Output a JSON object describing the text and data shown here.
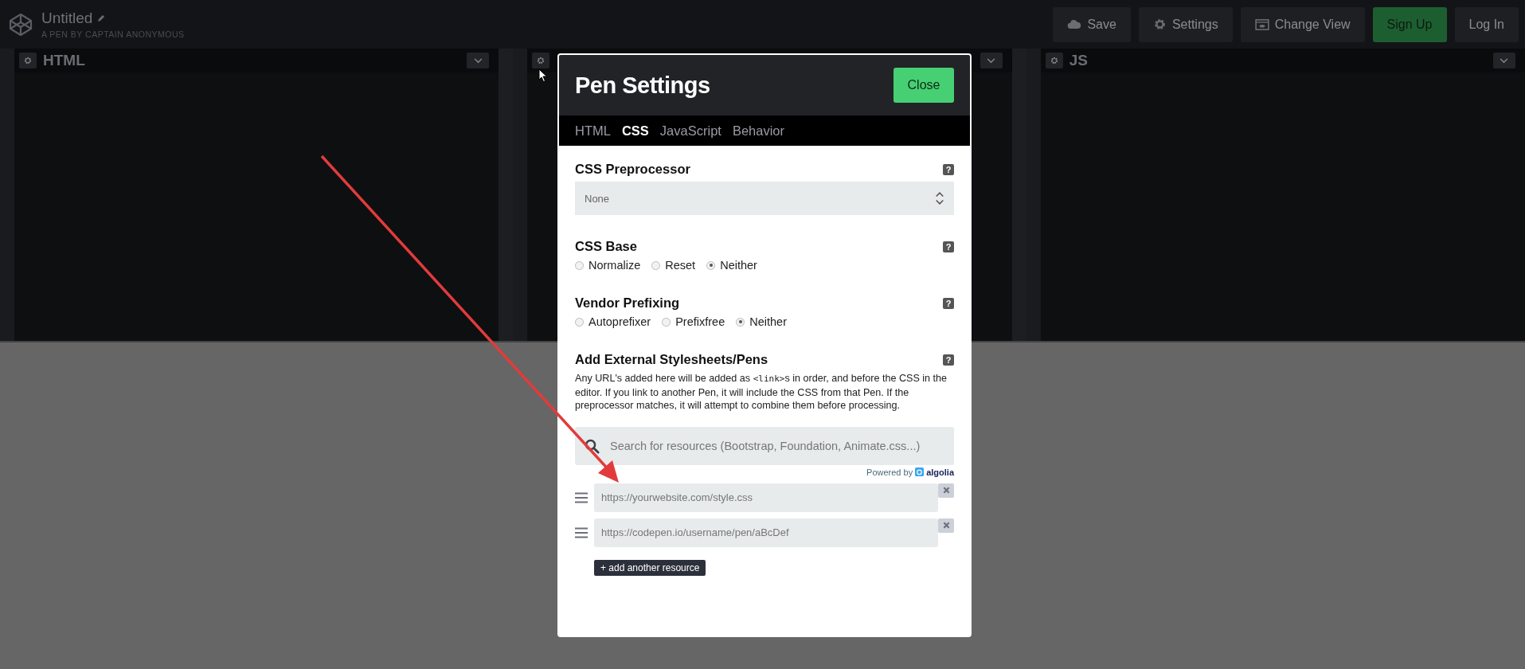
{
  "header": {
    "title": "Untitled",
    "subtitle": "A PEN BY CAPTAIN ANONYMOUS",
    "buttons": [
      {
        "label": "Save",
        "kind": "save"
      },
      {
        "label": "Settings",
        "kind": "settings"
      },
      {
        "label": "Change View",
        "kind": "view"
      },
      {
        "label": "Sign Up",
        "kind": "signup"
      },
      {
        "label": "Log In",
        "kind": "login"
      }
    ]
  },
  "editors": [
    {
      "kind": "labeled",
      "label": "HTML"
    },
    {
      "kind": "unlabeled"
    },
    {
      "kind": "labeled",
      "label": "JS"
    }
  ],
  "modal": {
    "title": "Pen Settings",
    "close": "Close",
    "tabs": [
      {
        "label": "HTML",
        "selected": false
      },
      {
        "label": "CSS",
        "selected": true
      },
      {
        "label": "JavaScript",
        "selected": false
      },
      {
        "label": "Behavior",
        "selected": false
      }
    ],
    "sections": [
      {
        "kind": "select",
        "heading": "CSS Preprocessor",
        "help": "?",
        "value": "None"
      },
      {
        "kind": "radio",
        "heading": "CSS Base",
        "help": "?",
        "options": [
          {
            "label": "Normalize",
            "selected": false
          },
          {
            "label": "Reset",
            "selected": false
          },
          {
            "label": "Neither",
            "selected": true
          }
        ]
      },
      {
        "kind": "radio",
        "heading": "Vendor Prefixing",
        "help": "?",
        "options": [
          {
            "label": "Autoprefixer",
            "selected": false
          },
          {
            "label": "Prefixfree",
            "selected": false
          },
          {
            "label": "Neither",
            "selected": true
          }
        ]
      },
      {
        "kind": "resources",
        "heading": "Add External Stylesheets/Pens",
        "help": "?",
        "description": {
          "before": "Any URL's added here will be added as ",
          "code": "<link>",
          "after": "s in order, and before the CSS in the editor. If you link to another Pen, it will include the CSS from that Pen. If the preprocessor matches, it will attempt to combine them before processing."
        },
        "search_placeholder": "Search for resources (Bootstrap, Foundation, Animate.css...)",
        "powered_by": "Powered by",
        "brand": "algolia",
        "resources": [
          {
            "placeholder": "https://yourwebsite.com/style.css"
          },
          {
            "placeholder": "https://codepen.io/username/pen/aBcDef"
          }
        ],
        "add_button": "+ add another resource"
      }
    ]
  }
}
